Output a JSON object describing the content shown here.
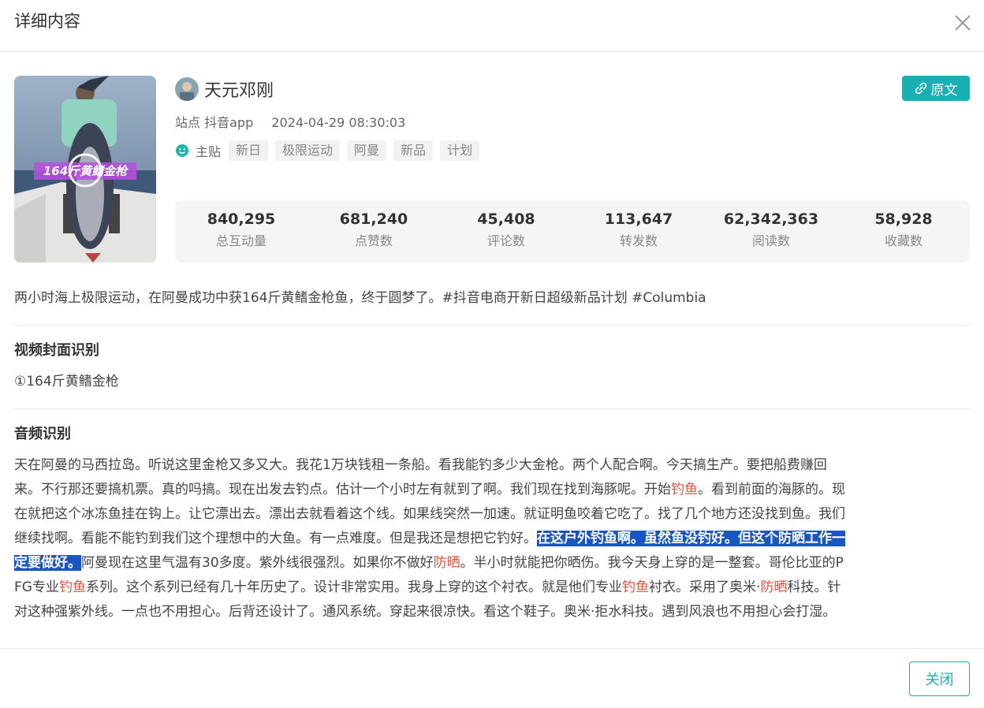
{
  "modal": {
    "title": "详细内容",
    "close_icon": "close-icon"
  },
  "post": {
    "author": "天元邓刚",
    "source_button": "原文",
    "site_label": "站点",
    "site": "抖音app",
    "datetime": "2024-04-29 08:30:03",
    "main_post_label": "主贴",
    "tags": [
      "新日",
      "极限运动",
      "阿曼",
      "新品",
      "计划"
    ],
    "thumbnail_caption": "164斤黄鳍金枪"
  },
  "stats": [
    {
      "value": "840,295",
      "label": "总互动量"
    },
    {
      "value": "681,240",
      "label": "点赞数"
    },
    {
      "value": "45,408",
      "label": "评论数"
    },
    {
      "value": "113,647",
      "label": "转发数"
    },
    {
      "value": "62,342,363",
      "label": "阅读数"
    },
    {
      "value": "58,928",
      "label": "收藏数"
    }
  ],
  "description": "两小时海上极限运动，在阿曼成功中获164斤黄鳍金枪鱼，终于圆梦了。#抖音电商开新日超级新品计划 #Columbia",
  "cover_recognition": {
    "title": "视频封面识别",
    "text": "①164斤黄鳍金枪"
  },
  "audio_recognition": {
    "title": "音频识别",
    "l1": "天在阿曼的马西拉岛。听说这里金枪又多又大。我花1万块钱租一条船。看我能钓多少大金枪。两个人配合啊。今天搞生产。要把船费赚回",
    "l2a": "来。不行那还要搞机票。真的吗搞。现在出发去钓点。估计一个小时左有就到了啊。我们现在找到海豚呢。开始",
    "l2b": "钓鱼",
    "l2c": "。看到前面的海豚的。现",
    "l3": "在就把这个冰冻鱼挂在钩上。让它漂出去。漂出去就看着这个线。如果线突然一加速。就证明鱼咬着它吃了。找了几个地方还没找到鱼。我们",
    "l4a": "继续找啊。看能不能钓到我们这个理想中的大鱼。有一点难度。但是我还是想把它钓好。",
    "l4b": "在这户外钓鱼啊。虽然鱼没钓好。但这个防晒工作一",
    "l5a": "定要做好。",
    "l5b": "阿曼现在这里气温有30多度。紫外线很强烈。如果你不做好",
    "l5c": "防晒",
    "l5d": "。半小时就能把你晒伤。我今天身上穿的是一整套。哥伦比亚的P",
    "l6a": "FG专业",
    "l6b": "钓鱼",
    "l6c": "系列。这个系列已经有几十年历史了。设计非常实用。我身上穿的这个衬衣。就是他们专业",
    "l6d": "钓鱼",
    "l6e": "衬衣。采用了奥米·",
    "l6f": "防晒",
    "l6g": "科技。针",
    "l7": "对这种强紫外线。一点也不用担心。后背还设计了。通风系统。穿起来很凉快。看这个鞋子。奥米·拒水科技。遇到风浪也不用担心会打湿。"
  },
  "footer": {
    "close_button": "关闭"
  },
  "colors": {
    "accent": "#17b1b3",
    "keyword": "#e8503a",
    "selection": "#1a55c8"
  }
}
